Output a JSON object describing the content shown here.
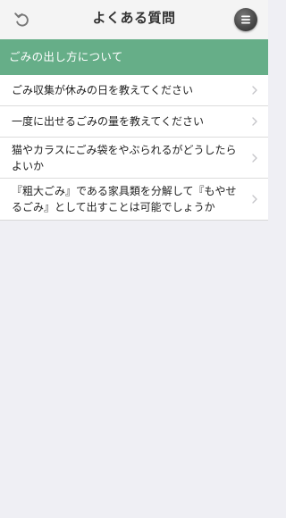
{
  "nav": {
    "title": "よくある質問",
    "back_icon": "undo-icon",
    "menu_icon": "menu-icon"
  },
  "section": {
    "title": "ごみの出し方について"
  },
  "faq_items": [
    {
      "label": "ごみ収集が休みの日を教えてください"
    },
    {
      "label": "一度に出せるごみの量を教えてください"
    },
    {
      "label": "猫やカラスにごみ袋をやぶられるがどうしたらよいか"
    },
    {
      "label": "『粗大ごみ』である家具類を分解して『もやせるごみ』として出すことは可能でしょうか"
    }
  ],
  "colors": {
    "section_header": "#66ae88",
    "background": "#efeff4",
    "nav_bar": "#f4f4f4"
  }
}
